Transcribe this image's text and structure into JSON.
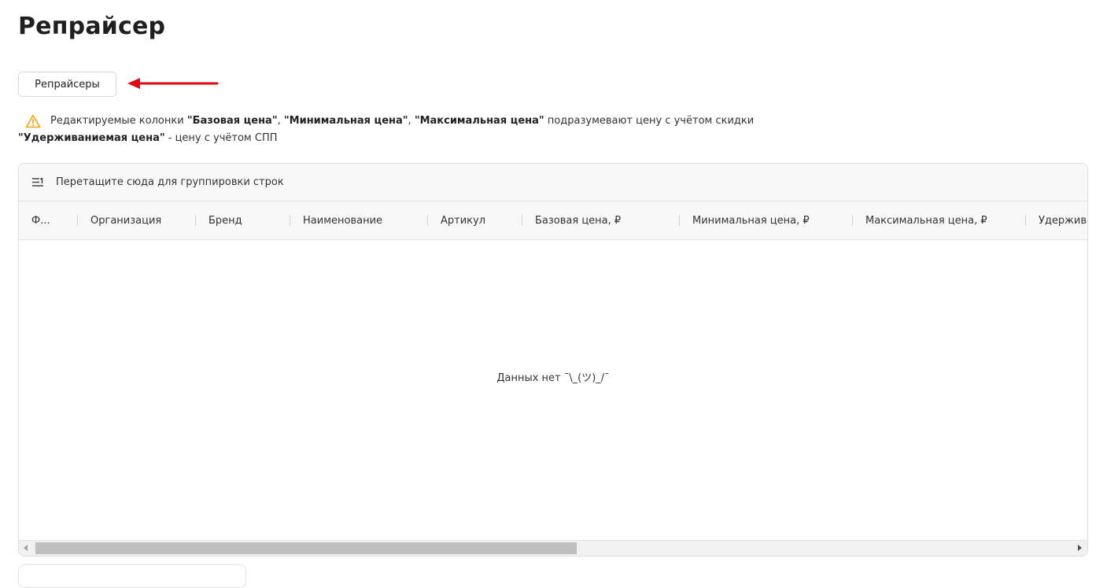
{
  "page": {
    "title": "Репрайсер"
  },
  "toolbar": {
    "repricers_button": "Репрайсеры"
  },
  "notice": {
    "part1": "Редактируемые колонки ",
    "col_base": "\"Базовая цена\"",
    "sep1": ", ",
    "col_min": "\"Минимальная цена\"",
    "sep2": ", ",
    "col_max": "\"Максимальная цена\"",
    "part2": " подразумевают цену с учётом скидки",
    "col_hold": "\"Удерживаниемая цена\"",
    "part3": " - цену с учётом СПП"
  },
  "grid": {
    "group_panel_text": "Перетащите сюда для группировки строк",
    "columns": [
      {
        "label": "Ф..."
      },
      {
        "label": "Организация"
      },
      {
        "label": "Бренд"
      },
      {
        "label": "Наименование"
      },
      {
        "label": "Артикул"
      },
      {
        "label": "Базовая цена, ₽"
      },
      {
        "label": "Минимальная цена, ₽"
      },
      {
        "label": "Максимальная цена, ₽"
      },
      {
        "label": "Удерживаемая цена, ₽"
      }
    ],
    "empty_text": "Данных нет ¯\\_(ツ)_/¯"
  },
  "colors": {
    "accent_arrow": "#e30613",
    "warning_icon": "#f5a300"
  }
}
